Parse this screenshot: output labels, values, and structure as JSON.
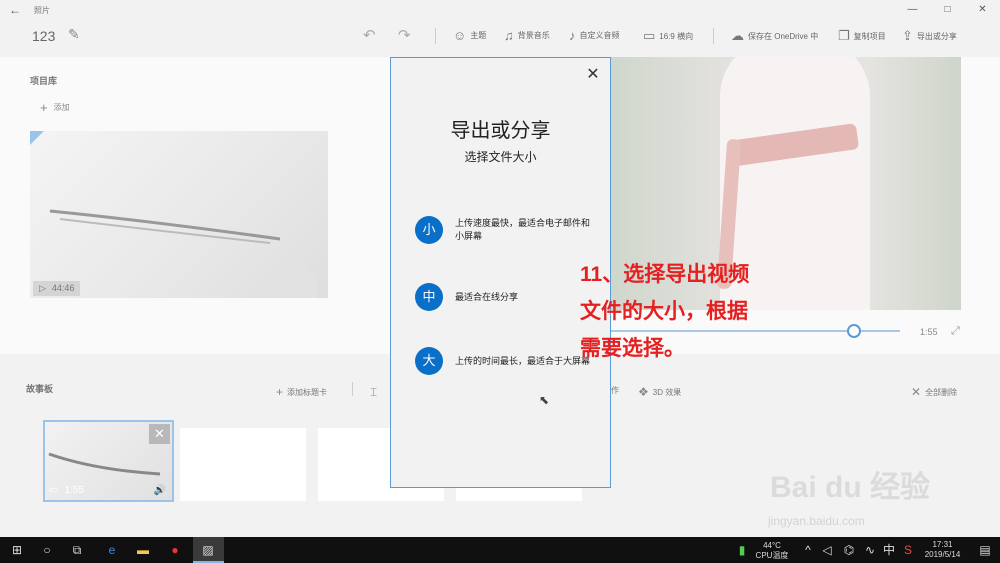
{
  "window": {
    "title": "照片",
    "back_icon": "arrow-left-icon",
    "controls": [
      "—",
      "□",
      "✕"
    ]
  },
  "toolbar": {
    "project_name": "123",
    "theme": "主题",
    "music": "背景音乐",
    "custom_audio": "自定义音频",
    "aspect": "16:9 横向",
    "save_onedrive": "保存在 OneDrive 中",
    "duplicate": "复制项目",
    "export": "导出或分享"
  },
  "library": {
    "title": "项目库",
    "add": "添加",
    "thumb_duration": "44:46"
  },
  "player": {
    "time": "1:55",
    "progress": 0.84
  },
  "storyboard": {
    "title": "故事板",
    "add_title_card": "添加标题卡",
    "effects_3d": "3D 效果",
    "partial_text": "作",
    "remove_all": "全部删除",
    "clip_duration": "1:55"
  },
  "dialog": {
    "title": "导出或分享",
    "subtitle": "选择文件大小",
    "options": [
      {
        "badge": "小",
        "text": "上传速度最快，最适合电子邮件和小屏幕"
      },
      {
        "badge": "中",
        "text": "最适合在线分享"
      },
      {
        "badge": "大",
        "text": "上传的时间最长，最适合于大屏幕"
      }
    ]
  },
  "annotation": {
    "line1": "11、选择导出视频",
    "line2": "文件的大小，根据",
    "line3": "需要选择。",
    "color": "#e52020"
  },
  "taskbar": {
    "temp": "44°C",
    "temp_label": "CPU温度",
    "ime": "中",
    "time": "17:31",
    "date": "2019/5/14"
  },
  "watermark": {
    "brand": "Bai du 经验",
    "url": "jingyan.baidu.com"
  },
  "colors": {
    "accent": "#0a6fc8",
    "dialog_border": "#5b9bd5"
  }
}
